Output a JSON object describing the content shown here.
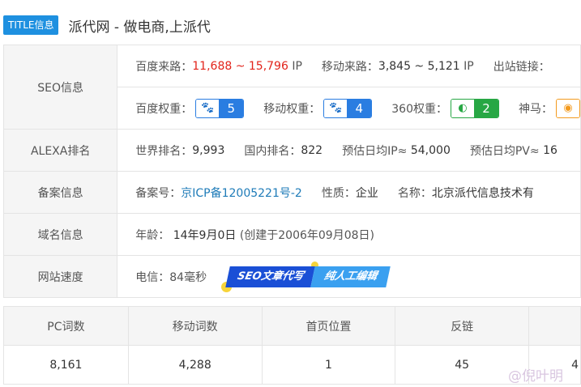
{
  "title_bar": {
    "badge": "TITLE信息",
    "text": "派代网 - 做电商,上派代"
  },
  "seo_info": {
    "label": "SEO信息",
    "baidu_traffic_label": "百度来路：",
    "baidu_traffic_value": "11,688 ~ 15,796",
    "baidu_traffic_unit": "IP",
    "mobile_traffic_label": "移动来路：",
    "mobile_traffic_value": "3,845 ~ 5,121",
    "mobile_traffic_unit": "IP",
    "outbound_label": "出站链接：",
    "baidu_weight_label": "百度权重：",
    "baidu_weight_value": "5",
    "mobile_weight_label": "移动权重：",
    "mobile_weight_value": "4",
    "weight_360_label": "360权重：",
    "weight_360_value": "2",
    "shenma_label": "神马："
  },
  "alexa": {
    "label": "ALEXA排名",
    "world_label": "世界排名：",
    "world_value": "9,993",
    "domestic_label": "国内排名：",
    "domestic_value": "822",
    "daily_ip_label": "预估日均IP≈",
    "daily_ip_value": "54,000",
    "daily_pv_label": "预估日均PV≈",
    "daily_pv_value": "16"
  },
  "icp": {
    "label": "备案信息",
    "number_label": "备案号：",
    "number_value": "京ICP备12005221号-2",
    "nature_label": "性质：",
    "nature_value": "企业",
    "name_label": "名称：",
    "name_value": "北京派代信息技术有"
  },
  "domain": {
    "label": "域名信息",
    "age_label": "年龄：",
    "age_value": "14年9月0日",
    "created": "(创建于2006年09月08日)"
  },
  "speed": {
    "label": "网站速度",
    "telecom": "电信：84毫秒",
    "banner_part1": "SEO文章代写",
    "banner_part2": "纯人工编辑"
  },
  "words_table": {
    "headers": [
      "PC词数",
      "移动词数",
      "首页位置",
      "反链",
      ""
    ],
    "values": [
      "8,161",
      "4,288",
      "1",
      "45",
      "4"
    ]
  },
  "watermark": "@倪叶明",
  "colors": {
    "accent": "#1e90e0",
    "red": "#e2231a",
    "link": "#1e7bb8",
    "badge_blue": "#2a7de1",
    "badge_green": "#27a744"
  }
}
